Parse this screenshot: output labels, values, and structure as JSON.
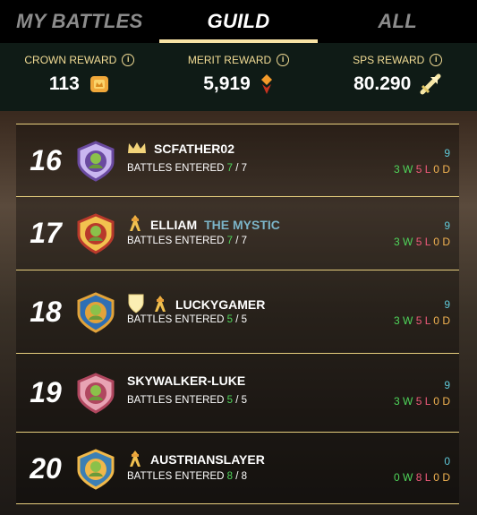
{
  "tabs": [
    {
      "label": "MY BATTLES",
      "active": false
    },
    {
      "label": "GUILD",
      "active": true
    },
    {
      "label": "ALL",
      "active": false
    }
  ],
  "rewards": [
    {
      "label": "CROWN REWARD",
      "value": "113",
      "icon": "crown-token-icon"
    },
    {
      "label": "MERIT REWARD",
      "value": "5,919",
      "icon": "merit-icon"
    },
    {
      "label": "SPS REWARD",
      "value": "80.290",
      "icon": "sps-token-icon"
    }
  ],
  "players": [
    {
      "rank": "16",
      "name": "SCFATHER02",
      "title": "",
      "badges": [
        "crown-icon"
      ],
      "entered_label": "BATTLES ENTERED",
      "entered": "7",
      "entered_sep": " / ",
      "total": "7",
      "score": "9",
      "wins": "3",
      "w": "W",
      "losses": "5",
      "l": "L",
      "draws": "0",
      "d": "D"
    },
    {
      "rank": "17",
      "name": "ELLIAM",
      "title": "THE MYSTIC",
      "badges": [
        "guild-hall-icon"
      ],
      "entered_label": "BATTLES ENTERED",
      "entered": "7",
      "entered_sep": " / ",
      "total": "7",
      "score": "9",
      "wins": "3",
      "w": "W",
      "losses": "5",
      "l": "L",
      "draws": "0",
      "d": "D"
    },
    {
      "rank": "18",
      "name": "LUCKYGAMER",
      "title": "",
      "badges": [
        "shield-icon",
        "guild-hall-icon"
      ],
      "entered_label": "BATTLES ENTERED",
      "entered": "5",
      "entered_sep": " / ",
      "total": "5",
      "score": "9",
      "wins": "3",
      "w": "W",
      "losses": "5",
      "l": "L",
      "draws": "0",
      "d": "D"
    },
    {
      "rank": "19",
      "name": "SKYWALKER-LUKE",
      "title": "",
      "badges": [],
      "entered_label": "BATTLES ENTERED",
      "entered": "5",
      "entered_sep": " / ",
      "total": "5",
      "score": "9",
      "wins": "3",
      "w": "W",
      "losses": "5",
      "l": "L",
      "draws": "0",
      "d": "D"
    },
    {
      "rank": "20",
      "name": "AUSTRIANSLAYER",
      "title": "",
      "badges": [
        "guild-hall-icon"
      ],
      "entered_label": "BATTLES ENTERED",
      "entered": "8",
      "entered_sep": " / ",
      "total": "8",
      "score": "0",
      "wins": "0",
      "w": "W",
      "losses": "8",
      "l": "L",
      "draws": "0",
      "d": "D"
    }
  ]
}
